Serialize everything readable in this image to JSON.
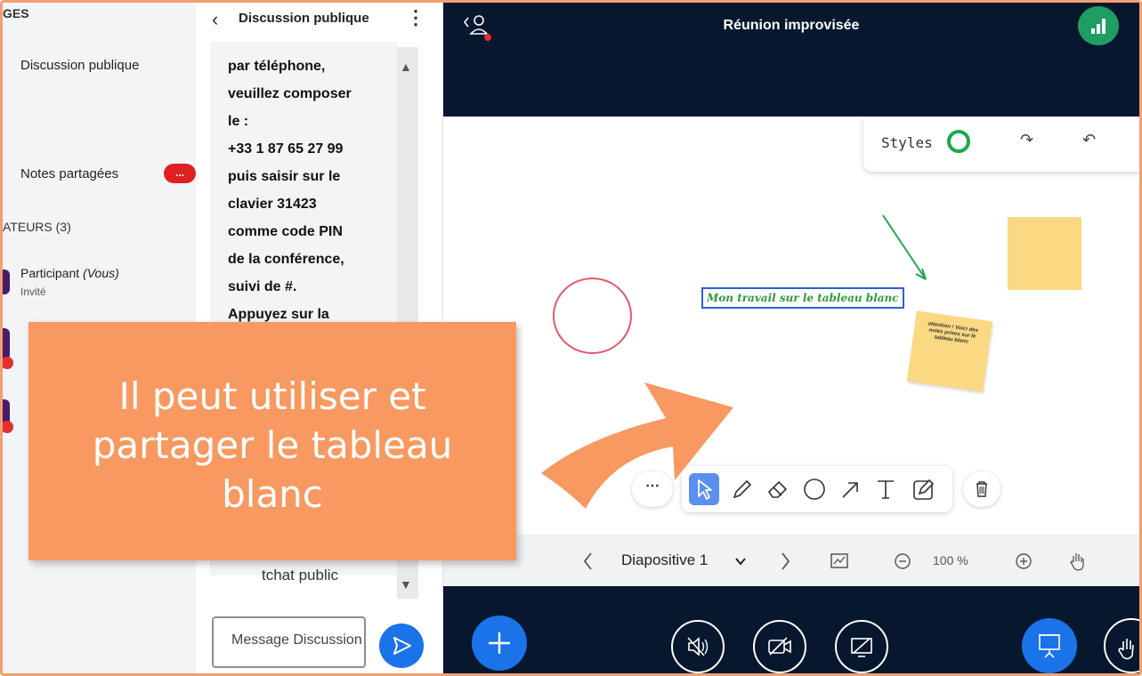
{
  "sidebar": {
    "section_messages": "GES",
    "public_chat": "Discussion publique",
    "shared_notes": "Notes partagées",
    "notes_badge": "...",
    "section_users": "ATEURS (3)",
    "participant_name": "Participant",
    "participant_you": "(Vous)",
    "participant_role": "Invité"
  },
  "chat": {
    "title": "Discussion publique",
    "message_lines": [
      "par téléphone,",
      "veuillez composer",
      "le :",
      "+33 1 87 65 27 99",
      "puis saisir sur le",
      "clavier 31423",
      "comme code PIN",
      "de la conférence,",
      "suivi de #.",
      "Appuyez sur la"
    ],
    "bottom_text": "tchat public",
    "input_placeholder": "Message Discussion"
  },
  "meeting": {
    "title": "Réunion improvisée"
  },
  "whiteboard": {
    "styles_label": "Styles",
    "text_item": "Mon travail sur le tableau blanc",
    "sticky_note": "attention ! Voici des notes prises sur le tableau blanc",
    "tools": [
      "select-icon",
      "pencil-icon",
      "eraser-icon",
      "circle-icon",
      "arrow-icon",
      "text-icon",
      "note-icon"
    ]
  },
  "slidebar": {
    "slide_name": "Diapositive 1",
    "zoom": "100 %"
  },
  "callout": {
    "text": "Il peut utiliser et partager le tableau blanc"
  },
  "colors": {
    "topbar": "#06172e",
    "accent_blue": "#1a73e8",
    "callout": "#f79960",
    "badge_red": "#e02020",
    "signal_green": "#1f9e64"
  }
}
